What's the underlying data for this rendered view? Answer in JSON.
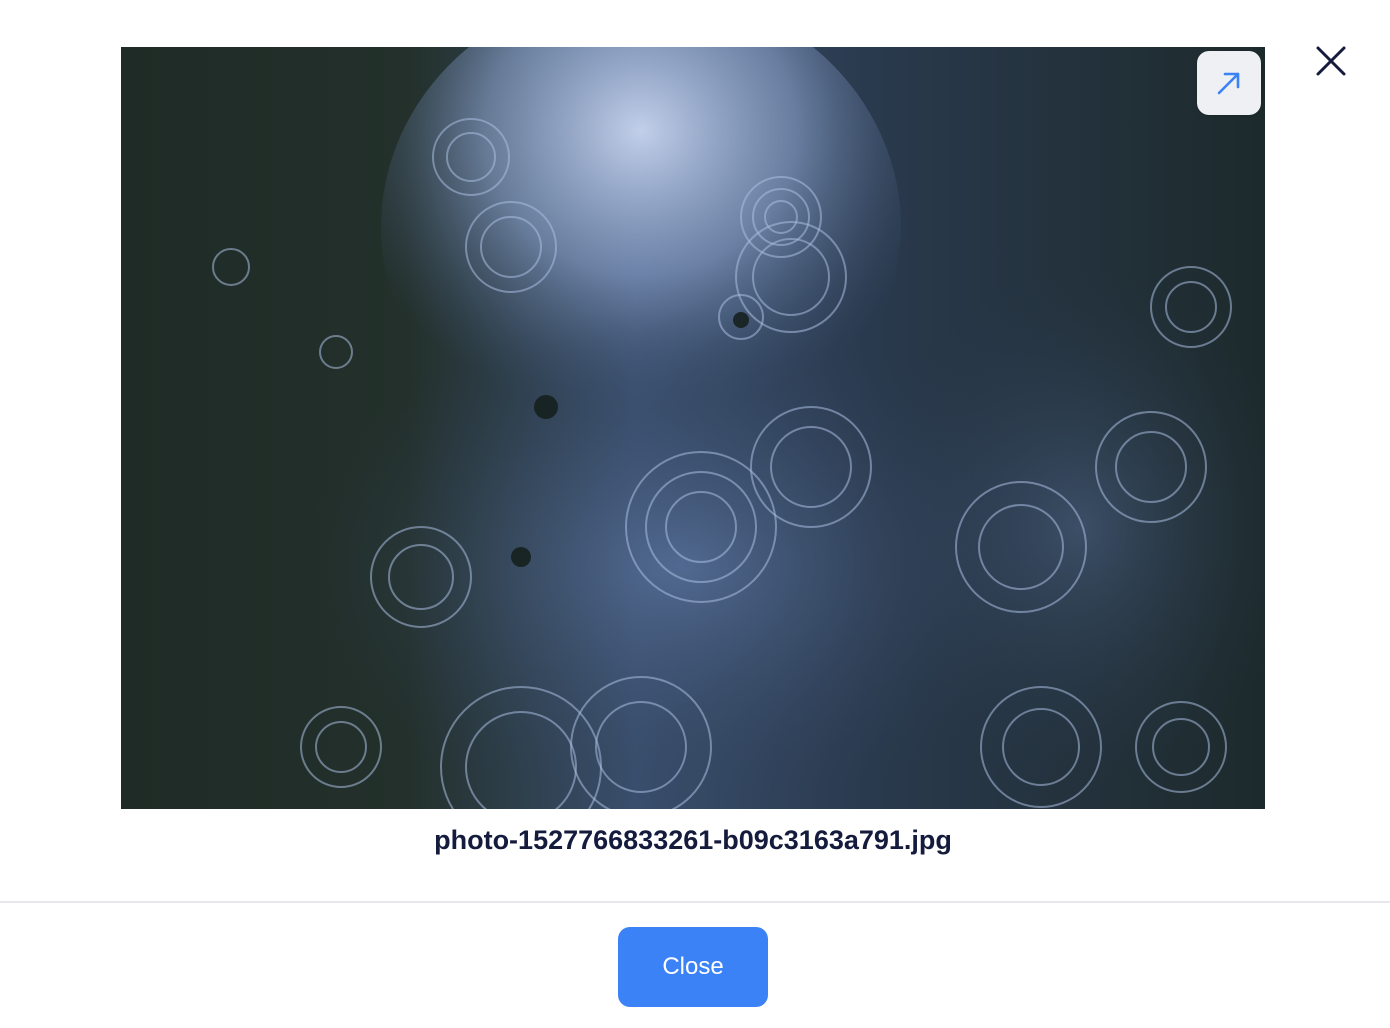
{
  "modal": {
    "image": {
      "filename": "photo-1527766833261-b09c3163a791.jpg",
      "description_icon": "rain-puddle-photo"
    },
    "open_button": {
      "icon": "open-external-arrow-icon"
    },
    "dismiss_icon": "close-icon",
    "footer": {
      "close_label": "Close"
    }
  },
  "colors": {
    "accent": "#3b82f6",
    "title": "#141b3d",
    "icon_blue": "#3b82f6"
  }
}
